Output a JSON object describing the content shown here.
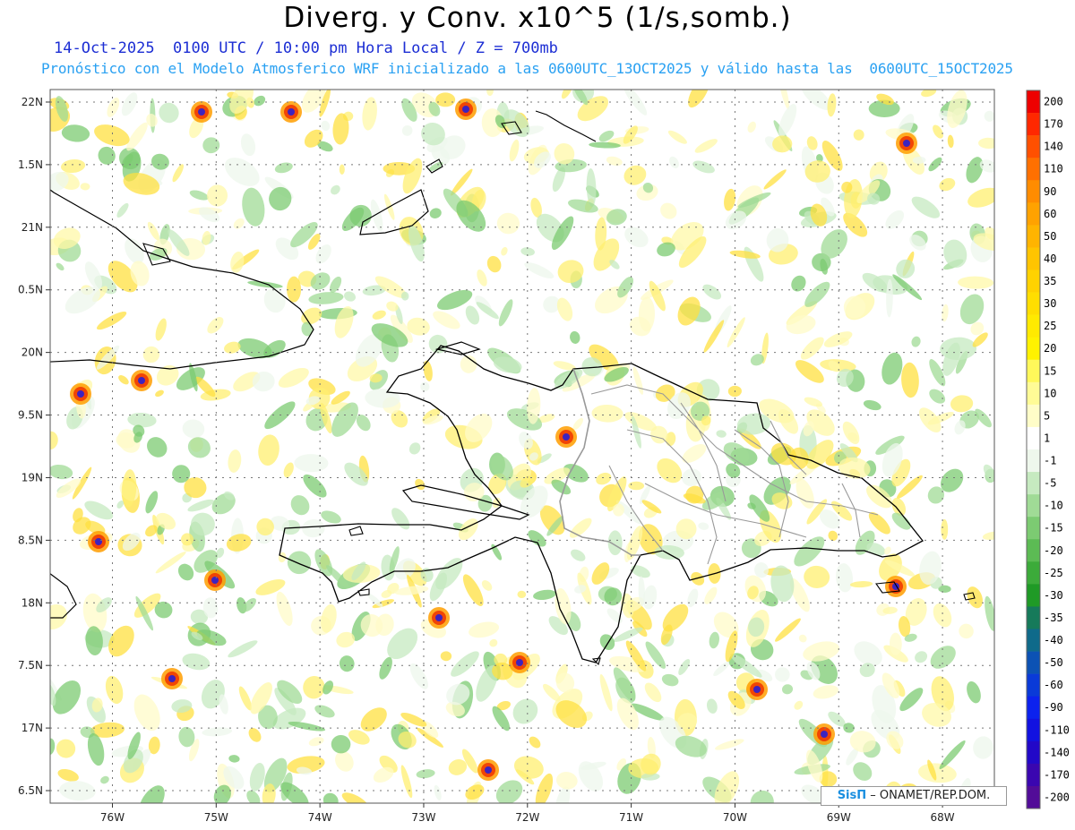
{
  "title": "Diverg. y Conv. x10^5 (1/s,somb.)",
  "subtitle": "14-Oct-2025  0100 UTC / 10:00 pm Hora Local / Z = 700mb",
  "forecast_line": "Pronóstico con el Modelo Atmosferico WRF inicializado a las 0600UTC_13OCT2025 y válido hasta las  0600UTC_15OCT2025",
  "credit": {
    "logo": "SisΠ",
    "text": "– ONAMET/REP.DOM."
  },
  "map": {
    "lon_range": [
      -76.6,
      -67.5
    ],
    "lat_range": [
      16.4,
      22.1
    ],
    "x_ticks": [
      {
        "lon": -76,
        "label": "76W"
      },
      {
        "lon": -75,
        "label": "75W"
      },
      {
        "lon": -74,
        "label": "74W"
      },
      {
        "lon": -73,
        "label": "73W"
      },
      {
        "lon": -72,
        "label": "72W"
      },
      {
        "lon": -71,
        "label": "71W"
      },
      {
        "lon": -70,
        "label": "70W"
      },
      {
        "lon": -69,
        "label": "69W"
      },
      {
        "lon": -68,
        "label": "68W"
      }
    ],
    "y_ticks": [
      {
        "lat": 22,
        "label": "22N"
      },
      {
        "lat": 21.5,
        "label": "1.5N"
      },
      {
        "lat": 21,
        "label": "21N"
      },
      {
        "lat": 20.5,
        "label": "0.5N"
      },
      {
        "lat": 20,
        "label": "20N"
      },
      {
        "lat": 19.5,
        "label": "9.5N"
      },
      {
        "lat": 19,
        "label": "19N"
      },
      {
        "lat": 18.5,
        "label": "8.5N"
      },
      {
        "lat": 18,
        "label": "18N"
      },
      {
        "lat": 17.5,
        "label": "7.5N"
      },
      {
        "lat": 17,
        "label": "17N"
      },
      {
        "lat": 16.5,
        "label": "6.5N"
      }
    ],
    "grid": true
  },
  "colorbar": {
    "labels": [
      "200",
      "170",
      "140",
      "110",
      "90",
      "60",
      "50",
      "40",
      "35",
      "30",
      "25",
      "20",
      "15",
      "10",
      "5",
      "1",
      "-1",
      "-5",
      "-10",
      "-15",
      "-20",
      "-25",
      "-30",
      "-35",
      "-40",
      "-50",
      "-60",
      "-90",
      "-110",
      "-140",
      "-170",
      "-200"
    ],
    "colors": [
      "#ee0000",
      "#ff2800",
      "#ff5000",
      "#ff7000",
      "#ff8c00",
      "#ffa200",
      "#ffb400",
      "#ffc400",
      "#ffd200",
      "#ffde00",
      "#ffea00",
      "#fff200",
      "#fff85a",
      "#fffb96",
      "#fffdc8",
      "#ffffff",
      "#eef7ec",
      "#c6eac0",
      "#a0db96",
      "#7ccb72",
      "#5cbb54",
      "#3cab3a",
      "#1f9a26",
      "#167a5a",
      "#0f6a8a",
      "#0c52b4",
      "#0a3ad8",
      "#0c22ee",
      "#1212e0",
      "#2208c8",
      "#3a06b0",
      "#520c98"
    ]
  },
  "places": [
    {
      "lon": -72.34,
      "lat": 18.54,
      "label": ""
    }
  ]
}
